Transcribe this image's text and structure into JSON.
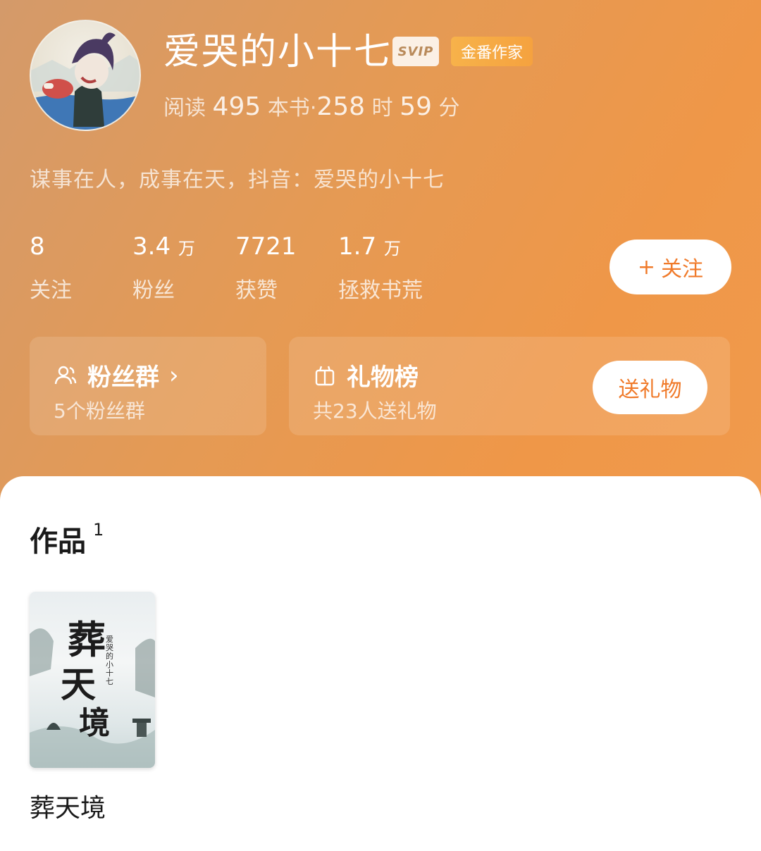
{
  "profile": {
    "name": "爱哭的小十七",
    "svip_badge": "SVIP",
    "writer_badge": "金番作家",
    "read_label": "阅读",
    "books_read": "495",
    "books_unit": "本书",
    "separator": "·",
    "hours": "258",
    "hours_unit": "时",
    "minutes": "59",
    "minutes_unit": "分",
    "bio": "谋事在人，成事在天，抖音：爱哭的小十七"
  },
  "stats": [
    {
      "value": "8",
      "unit": "",
      "label": "关注"
    },
    {
      "value": "3.4",
      "unit": "万",
      "label": "粉丝"
    },
    {
      "value": "7721",
      "unit": "",
      "label": "获赞"
    },
    {
      "value": "1.7",
      "unit": "万",
      "label": "拯救书荒"
    }
  ],
  "follow_button": {
    "plus": "+",
    "label": "关注"
  },
  "fan_group": {
    "title": "粉丝群",
    "chevron": "›",
    "subtitle": "5个粉丝群",
    "icon": "people-icon"
  },
  "gift_rank": {
    "title": "礼物榜",
    "subtitle": "共23人送礼物",
    "button": "送礼物",
    "icon": "gift-icon"
  },
  "works": {
    "title": "作品",
    "count": "1",
    "items": [
      {
        "title": "葬天境",
        "cover_chars": [
          "葬",
          "天",
          "境"
        ],
        "cover_author": "爱哭的小十七"
      }
    ]
  },
  "colors": {
    "accent": "#f07a2a",
    "hero": "#ef9748"
  }
}
